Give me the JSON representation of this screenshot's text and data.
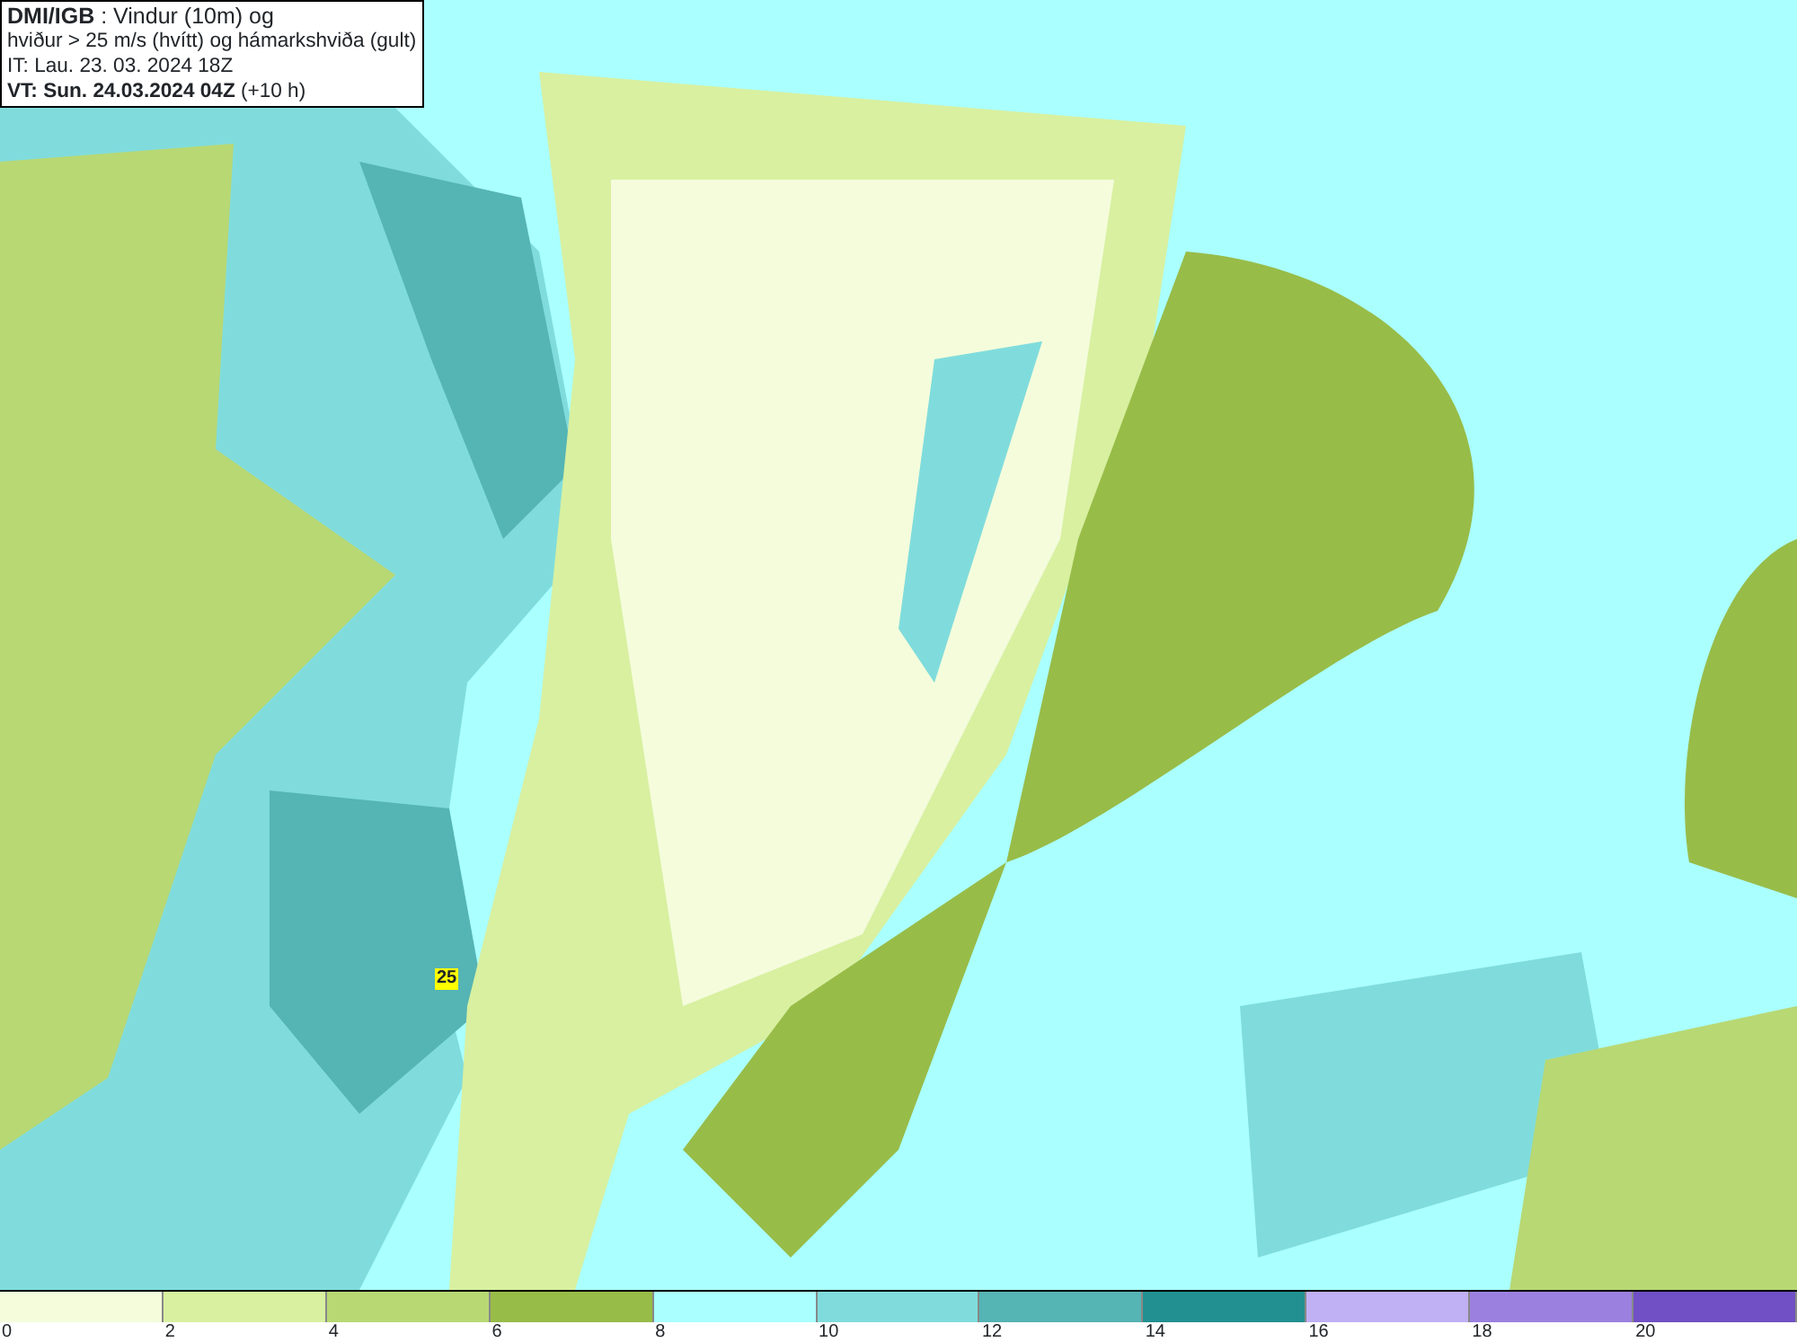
{
  "header": {
    "lines": [
      "**DMI/IGB** : Vindur (10m) og",
      "hviður > 25 m/s (hvítt) og hámarkshviða (gult)",
      "IT: Lau. 23. 03. 2024 18Z",
      "**VT: Sun. 24.03.2024 04Z** (+10 h)"
    ]
  },
  "map": {
    "gust_labels": [
      "25"
    ]
  },
  "legend": [
    {
      "color": "#f4fcdc",
      "label": "0"
    },
    {
      "color": "#d8f0a0",
      "label": "2"
    },
    {
      "color": "#b8d874",
      "label": "4"
    },
    {
      "color": "#98bc48",
      "label": "6"
    },
    {
      "color": "#aaffff",
      "label": "8"
    },
    {
      "color": "#80dcdc",
      "label": "10"
    },
    {
      "color": "#55b4b4",
      "label": "12"
    },
    {
      "color": "#229090",
      "label": "14"
    },
    {
      "color": "#c0b0f4",
      "label": "16"
    },
    {
      "color": "#9c80e0",
      "label": "18"
    },
    {
      "color": "#7050c4",
      "label": "20"
    }
  ]
}
